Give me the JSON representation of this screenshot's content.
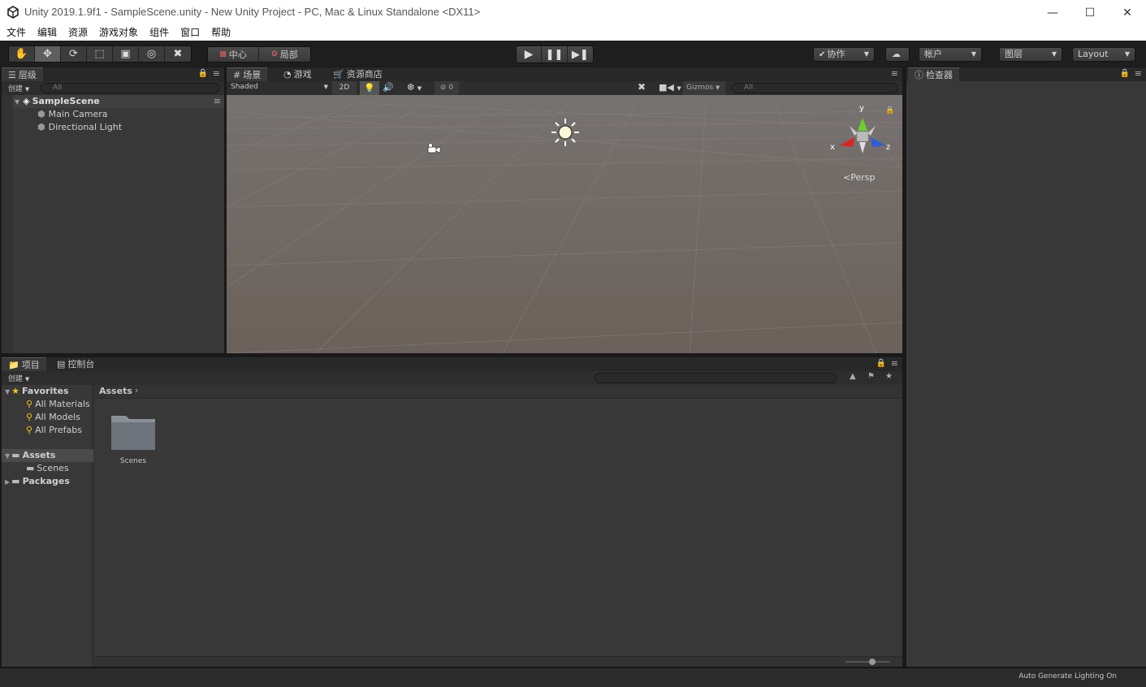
{
  "window": {
    "title": "Unity 2019.1.9f1 - SampleScene.unity - New Unity Project - PC, Mac & Linux Standalone <DX11>",
    "minimize_icon": "minimize-icon",
    "maximize_icon": "maximize-icon",
    "close_icon": "close-icon"
  },
  "menu": [
    "文件",
    "编辑",
    "资源",
    "游戏对象",
    "组件",
    "窗口",
    "帮助"
  ],
  "toolbar": {
    "tools": [
      "hand-icon",
      "move-icon",
      "rotate-icon",
      "scale-icon",
      "rect-icon",
      "transform-icon",
      "custom-tool-icon"
    ],
    "pivot_label": "中心",
    "local_label": "局部",
    "collab_label": "协作",
    "account_label": "帐户",
    "layers_label": "图层",
    "layout_label": "Layout"
  },
  "hierarchy": {
    "tab_label": "层级",
    "create_label": "创建",
    "search_placeholder": "All",
    "scene_name": "SampleScene",
    "objects": [
      "Main Camera",
      "Directional Light"
    ]
  },
  "scene": {
    "tabs": [
      "场景",
      "游戏",
      "资源商店"
    ],
    "shading": "Shaded",
    "mode_2d": "2D",
    "hidden_count": "0",
    "gizmos_label": "Gizmos",
    "search_placeholder": "All",
    "axis_y": "y",
    "axis_x": "x",
    "axis_z": "z",
    "persp_label": "Persp"
  },
  "inspector": {
    "tab_label": "检查器"
  },
  "project": {
    "tabs": [
      "项目",
      "控制台"
    ],
    "create_label": "创建",
    "favorites_label": "Favorites",
    "favorites": [
      "All Materials",
      "All Models",
      "All Prefabs"
    ],
    "assets_label": "Assets",
    "asset_children": [
      "Scenes"
    ],
    "packages_label": "Packages",
    "breadcrumb": "Assets",
    "grid_items": [
      "Scenes"
    ]
  },
  "status": {
    "text": "Auto Generate Lighting On"
  }
}
